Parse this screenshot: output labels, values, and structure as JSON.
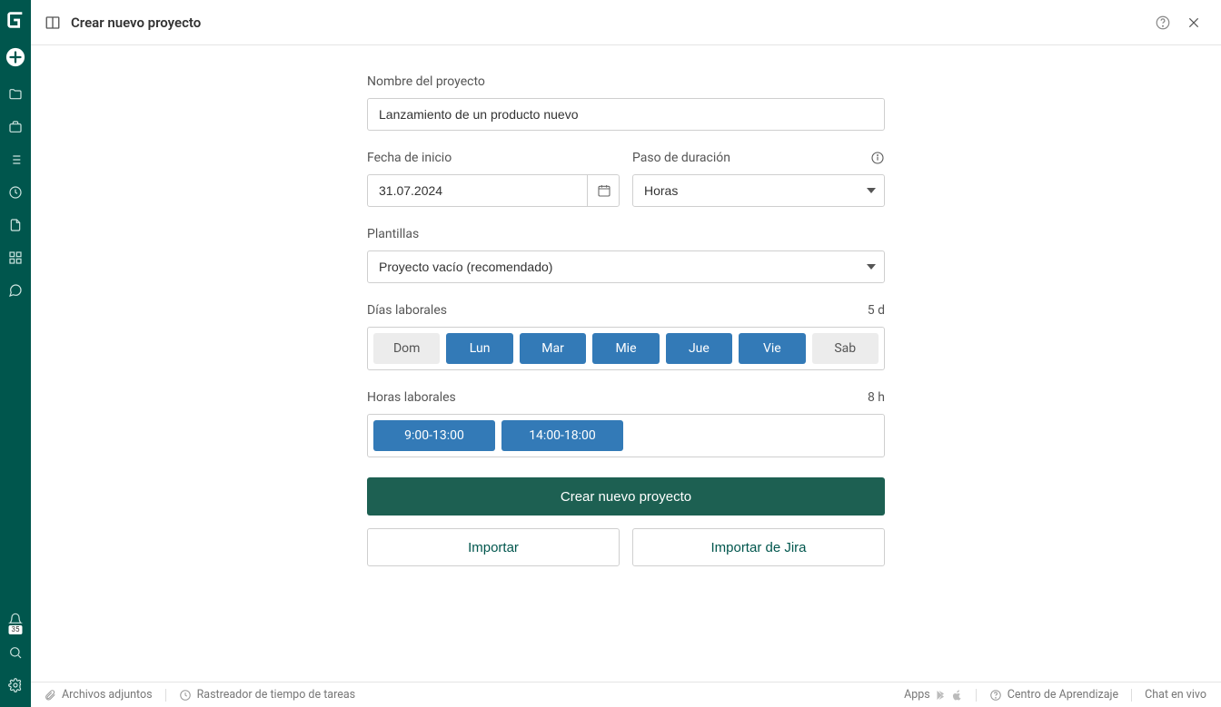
{
  "header": {
    "title": "Crear nuevo proyecto"
  },
  "form": {
    "project_name_label": "Nombre del proyecto",
    "project_name_value": "Lanzamiento de un producto nuevo",
    "start_date_label": "Fecha de inicio",
    "start_date_value": "31.07.2024",
    "duration_step_label": "Paso de duración",
    "duration_step_value": "Horas",
    "templates_label": "Plantillas",
    "templates_value": "Proyecto vacío (recomendado)",
    "working_days_label": "Días laborales",
    "working_days_summary": "5 d",
    "days": [
      {
        "label": "Dom",
        "on": false
      },
      {
        "label": "Lun",
        "on": true
      },
      {
        "label": "Mar",
        "on": true
      },
      {
        "label": "Mie",
        "on": true
      },
      {
        "label": "Jue",
        "on": true
      },
      {
        "label": "Vie",
        "on": true
      },
      {
        "label": "Sab",
        "on": false
      }
    ],
    "working_hours_label": "Horas laborales",
    "working_hours_summary": "8 h",
    "hours": [
      "9:00-13:00",
      "14:00-18:00"
    ],
    "create_button": "Crear nuevo proyecto",
    "import_button": "Importar",
    "import_jira_button": "Importar de Jira"
  },
  "statusbar": {
    "attachments": "Archivos adjuntos",
    "time_tracker": "Rastreador de tiempo de tareas",
    "apps": "Apps",
    "learning_center": "Centro de Aprendizaje",
    "live_chat": "Chat en vivo"
  },
  "sidebar": {
    "notification_badge": "35"
  }
}
